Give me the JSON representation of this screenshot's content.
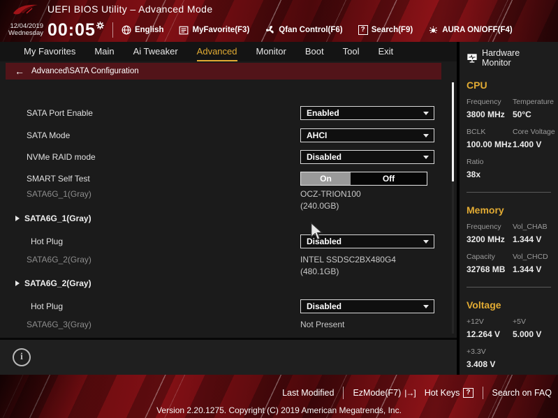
{
  "window": {
    "title": "UEFI BIOS Utility – Advanced Mode"
  },
  "clock": {
    "date": "12/04/2019",
    "weekday": "Wednesday",
    "time": "00:05"
  },
  "quickbar": {
    "language": "English",
    "myfavorite": "MyFavorite(F3)",
    "qfan": "Qfan Control(F6)",
    "search": "Search(F9)",
    "aura": "AURA ON/OFF(F4)"
  },
  "icons": {
    "search_badge": "?",
    "hotkeys_badge": "?",
    "ezmode_glyph": "|→]",
    "back_arrow": "←",
    "info_glyph": "i"
  },
  "menu": {
    "tabs": [
      {
        "label": "My Favorites"
      },
      {
        "label": "Main"
      },
      {
        "label": "Ai Tweaker"
      },
      {
        "label": "Advanced"
      },
      {
        "label": "Monitor"
      },
      {
        "label": "Boot"
      },
      {
        "label": "Tool"
      },
      {
        "label": "Exit"
      }
    ]
  },
  "breadcrumb": {
    "path": "Advanced\\SATA Configuration"
  },
  "settings": {
    "rows": [
      {
        "type": "dropdown",
        "label": "SATA Port Enable",
        "value": "Enabled"
      },
      {
        "type": "dropdown",
        "label": "SATA Mode",
        "value": "AHCI"
      },
      {
        "type": "dropdown",
        "label": "NVMe RAID mode",
        "value": "Disabled"
      },
      {
        "type": "toggle",
        "label": "SMART Self Test",
        "on": "On",
        "off": "Off",
        "selected": "On"
      },
      {
        "type": "info",
        "label": "SATA6G_1(Gray)",
        "value_line1": "OCZ-TRION100",
        "value_line2": "(240.0GB)"
      },
      {
        "type": "group",
        "label": "SATA6G_1(Gray)"
      },
      {
        "type": "dropdown",
        "label": "Hot Plug",
        "value": "Disabled"
      },
      {
        "type": "info",
        "label": "SATA6G_2(Gray)",
        "value_line1": "INTEL SSDSC2BX480G4",
        "value_line2": "(480.1GB)"
      },
      {
        "type": "group",
        "label": "SATA6G_2(Gray)"
      },
      {
        "type": "dropdown",
        "label": "Hot Plug",
        "value": "Disabled"
      },
      {
        "type": "info",
        "label": "SATA6G_3(Gray)",
        "value_line1": "Not Present"
      }
    ]
  },
  "hardware_monitor": {
    "title": "Hardware Monitor",
    "cpu": {
      "title": "CPU",
      "metrics": [
        {
          "label": "Frequency",
          "value": "3800 MHz"
        },
        {
          "label": "Temperature",
          "value": "50°C"
        },
        {
          "label": "BCLK",
          "value": "100.00 MHz"
        },
        {
          "label": "Core Voltage",
          "value": "1.400 V"
        },
        {
          "label": "Ratio",
          "value": "38x"
        }
      ]
    },
    "memory": {
      "title": "Memory",
      "metrics": [
        {
          "label": "Frequency",
          "value": "3200 MHz"
        },
        {
          "label": "Vol_CHAB",
          "value": "1.344 V"
        },
        {
          "label": "Capacity",
          "value": "32768 MB"
        },
        {
          "label": "Vol_CHCD",
          "value": "1.344 V"
        }
      ]
    },
    "voltage": {
      "title": "Voltage",
      "metrics": [
        {
          "label": "+12V",
          "value": "12.264 V"
        },
        {
          "label": "+5V",
          "value": "5.000 V"
        },
        {
          "label": "+3.3V",
          "value": "3.408 V"
        }
      ]
    }
  },
  "footer": {
    "last_modified": "Last Modified",
    "ezmode": "EzMode(F7)",
    "hotkeys": "Hot Keys",
    "faq": "Search on FAQ",
    "version": "Version 2.20.1275. Copyright (C) 2019 American Megatrends, Inc."
  },
  "colors": {
    "accent_gold": "#e2ab33",
    "rog_red": "#c21a1f",
    "breadcrumb_red": "#521419"
  }
}
